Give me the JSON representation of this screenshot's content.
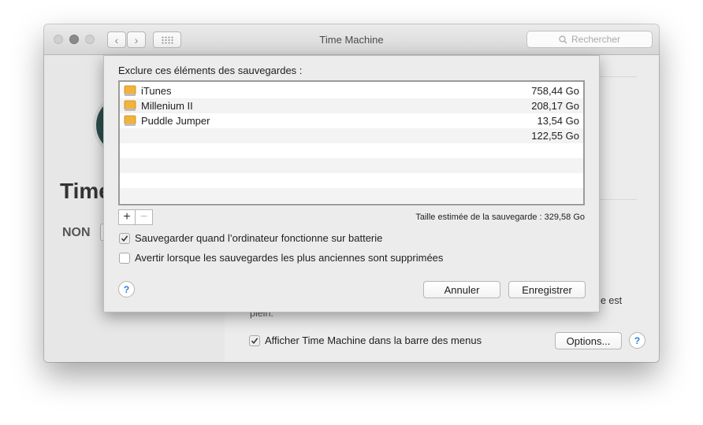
{
  "window": {
    "title": "Time Machine",
    "search_placeholder": "Rechercher",
    "back_glyph": "‹",
    "forward_glyph": "›"
  },
  "background": {
    "big_title": "Time",
    "toggle_label": "NON",
    "partial_text_right": "e est",
    "partial_text_plein": "plein.",
    "menu_checkbox_label": "Afficher Time Machine dans la barre des menus",
    "menu_checkbox_checked": true,
    "options_button": "Options...",
    "help_glyph": "?"
  },
  "sheet": {
    "exclude_label": "Exclure ces éléments des sauvegardes :",
    "items": [
      {
        "name": "iTunes",
        "size": "758,44 Go",
        "icon": "folder-drive-icon"
      },
      {
        "name": "Millenium II",
        "size": "208,17 Go",
        "icon": "folder-drive-icon"
      },
      {
        "name": "Puddle Jumper",
        "size": "13,54 Go",
        "icon": "folder-drive-icon"
      },
      {
        "name": "",
        "size": "122,55 Go",
        "icon": ""
      }
    ],
    "add_glyph": "+",
    "remove_glyph": "−",
    "estimate_label": "Taille estimée de la sauvegarde : 329,58 Go",
    "battery_checkbox": {
      "label": "Sauvegarder quand l’ordinateur fonctionne sur batterie",
      "checked": true
    },
    "warn_checkbox": {
      "label": "Avertir lorsque les sauvegardes les plus anciennes sont supprimées",
      "checked": false
    },
    "help_glyph": "?",
    "cancel_button": "Annuler",
    "save_button": "Enregistrer"
  },
  "colors": {
    "accent": "#2a7fe0",
    "drive_icon": "#f0a92a"
  }
}
